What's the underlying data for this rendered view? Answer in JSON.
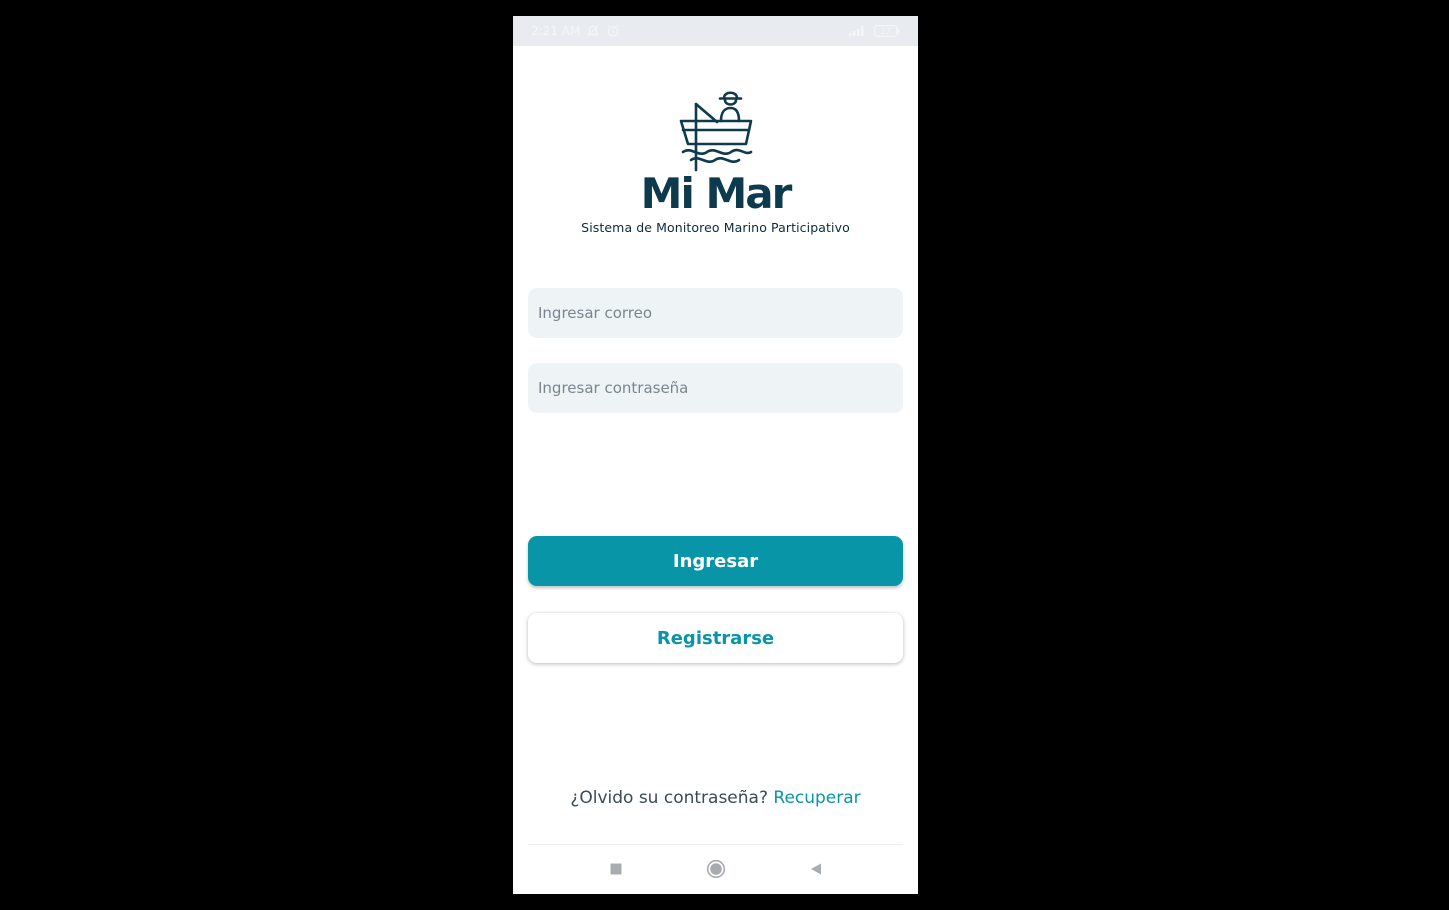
{
  "status_bar": {
    "time": "2:21 AM",
    "battery": "27"
  },
  "logo": {
    "title": "Mi Mar",
    "subtitle": "Sistema de Monitoreo Marino Participativo"
  },
  "form": {
    "email_placeholder": "Ingresar correo",
    "password_placeholder": "Ingresar contraseña",
    "login_label": "Ingresar",
    "register_label": "Registrarse"
  },
  "forgot": {
    "prompt": "¿Olvido su contraseña?",
    "link": "Recuperar"
  },
  "colors": {
    "accent": "#0895a8",
    "logo_dark": "#0e3a4d",
    "field_bg": "#eef4f6",
    "background": "#ffffff"
  },
  "icons": {
    "status_left": [
      "silent-mode-icon",
      "alarm-icon"
    ],
    "status_right": [
      "signal-icon",
      "battery-icon"
    ],
    "nav": [
      "recent-apps-icon",
      "home-icon",
      "back-icon"
    ]
  }
}
